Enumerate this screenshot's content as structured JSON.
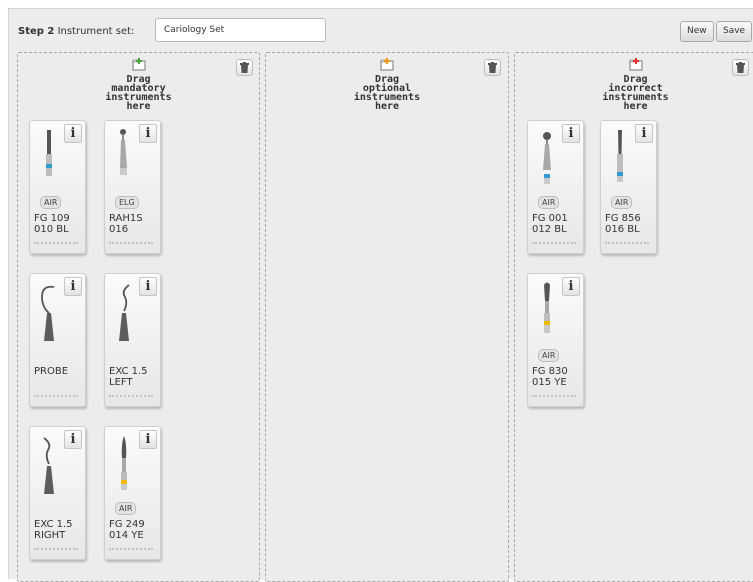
{
  "header": {
    "step": "Step 2",
    "set_label": "Instrument set:",
    "set_value": "Cariology Set",
    "new_button": "New",
    "save_button": "Save"
  },
  "zones": {
    "mandatory": {
      "title": [
        "Drag",
        "mandatory",
        "instruments",
        "here"
      ],
      "add_icon": "folder-plus-green-icon"
    },
    "optional": {
      "title": [
        "Drag",
        "optional",
        "instruments",
        "here"
      ],
      "add_icon": "folder-plus-orange-icon"
    },
    "incorrect": {
      "title": [
        "Drag",
        "incorrect",
        "instruments",
        "here"
      ],
      "add_icon": "folder-plus-red-icon"
    }
  },
  "instruments": {
    "mandatory": [
      {
        "line1": "FG 109",
        "line2": "010 BL",
        "badge": "AIR",
        "tool": "bur-cylinder",
        "band": "#2e9cd0"
      },
      {
        "line1": "RAH1S",
        "line2": "016",
        "badge": "ELG",
        "tool": "bur-ball-small",
        "band": ""
      },
      {
        "line1": "PROBE",
        "line2": "",
        "badge": "",
        "tool": "probe",
        "band": ""
      },
      {
        "line1": "EXC 1.5",
        "line2": "LEFT",
        "badge": "",
        "tool": "excavator-left",
        "band": ""
      },
      {
        "line1": "EXC 1.5",
        "line2": "RIGHT",
        "badge": "",
        "tool": "excavator-right",
        "band": ""
      },
      {
        "line1": "FG 249",
        "line2": "014 YE",
        "badge": "AIR",
        "tool": "bur-flame",
        "band": "#f0b800"
      }
    ],
    "optional": [],
    "incorrect": [
      {
        "line1": "FG 001",
        "line2": "012 BL",
        "badge": "AIR",
        "tool": "bur-ball",
        "band": "#2e9cd0"
      },
      {
        "line1": "FG 856",
        "line2": "016 BL",
        "badge": "AIR",
        "tool": "bur-taper",
        "band": "#2e9cd0"
      },
      {
        "line1": "FG 830",
        "line2": "015 YE",
        "badge": "AIR",
        "tool": "bur-pear",
        "band": "#f0b800"
      }
    ]
  },
  "icons": {
    "info": "i",
    "trash": "trash-icon"
  }
}
